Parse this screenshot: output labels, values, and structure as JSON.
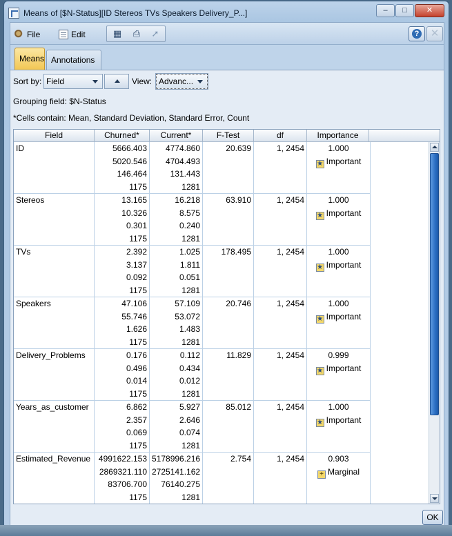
{
  "window": {
    "title": "Means of [$N-Status][ID Stereos TVs Speakers Delivery_P...]",
    "min_glyph": "–",
    "max_glyph": "□",
    "close_glyph": "✕"
  },
  "menu": {
    "file_label": "File",
    "edit_label": "Edit",
    "help_glyph": "?",
    "close_glyph": "✕"
  },
  "toolbar": {
    "btn1_icon": "report-icon",
    "btn2_icon": "print-icon",
    "btn3_icon": "export-icon"
  },
  "tabs": [
    {
      "label": "Means",
      "active": true
    },
    {
      "label": "Annotations",
      "active": false
    }
  ],
  "controls": {
    "sort_label": "Sort by:",
    "sort_value": "Field",
    "view_label": "View:",
    "view_value": "Advanc..."
  },
  "info": {
    "grouping": "Grouping field: $N-Status",
    "cells": "*Cells contain: Mean, Standard Deviation, Standard Error, Count"
  },
  "table": {
    "headers": [
      "Field",
      "Churned*",
      "Current*",
      "F-Test",
      "df",
      "Importance"
    ],
    "rows": [
      {
        "field": "ID",
        "churned": [
          "5666.403",
          "5020.546",
          "146.464",
          "1175"
        ],
        "current": [
          "4774.860",
          "4704.493",
          "131.443",
          "1281"
        ],
        "ftest": "20.639",
        "df": "1, 2454",
        "imp_value": "1.000",
        "imp_label": "Important",
        "imp_icon": "star-icon"
      },
      {
        "field": "Stereos",
        "churned": [
          "13.165",
          "10.326",
          "0.301",
          "1175"
        ],
        "current": [
          "16.218",
          "8.575",
          "0.240",
          "1281"
        ],
        "ftest": "63.910",
        "df": "1, 2454",
        "imp_value": "1.000",
        "imp_label": "Important",
        "imp_icon": "star-icon"
      },
      {
        "field": "TVs",
        "churned": [
          "2.392",
          "3.137",
          "0.092",
          "1175"
        ],
        "current": [
          "1.025",
          "1.811",
          "0.051",
          "1281"
        ],
        "ftest": "178.495",
        "df": "1, 2454",
        "imp_value": "1.000",
        "imp_label": "Important",
        "imp_icon": "star-icon"
      },
      {
        "field": "Speakers",
        "churned": [
          "47.106",
          "55.746",
          "1.626",
          "1175"
        ],
        "current": [
          "57.109",
          "53.072",
          "1.483",
          "1281"
        ],
        "ftest": "20.746",
        "df": "1, 2454",
        "imp_value": "1.000",
        "imp_label": "Important",
        "imp_icon": "star-icon"
      },
      {
        "field": "Delivery_Problems",
        "churned": [
          "0.176",
          "0.496",
          "0.014",
          "1175"
        ],
        "current": [
          "0.112",
          "0.434",
          "0.012",
          "1281"
        ],
        "ftest": "11.829",
        "df": "1, 2454",
        "imp_value": "0.999",
        "imp_label": "Important",
        "imp_icon": "star-icon"
      },
      {
        "field": "Years_as_customer",
        "churned": [
          "6.862",
          "2.357",
          "0.069",
          "1175"
        ],
        "current": [
          "5.927",
          "2.646",
          "0.074",
          "1281"
        ],
        "ftest": "85.012",
        "df": "1, 2454",
        "imp_value": "1.000",
        "imp_label": "Important",
        "imp_icon": "star-icon"
      },
      {
        "field": "Estimated_Revenue",
        "churned": [
          "4991622.153",
          "2869321.110",
          "83706.700",
          "1175"
        ],
        "current": [
          "5178996.216",
          "2725141.162",
          "76140.275",
          "1281"
        ],
        "ftest": "2.754",
        "df": "1, 2454",
        "imp_value": "0.903",
        "imp_label": "Marginal",
        "imp_icon": "plus-icon"
      }
    ]
  },
  "footer": {
    "ok_label": "OK"
  }
}
